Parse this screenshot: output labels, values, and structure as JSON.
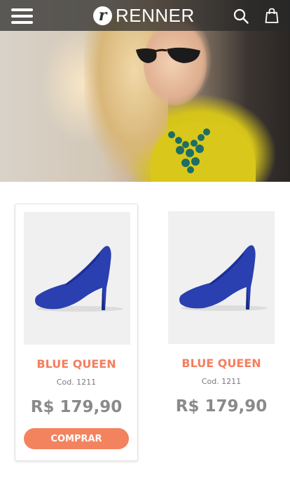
{
  "header": {
    "brand": "RENNER",
    "brand_mark": "r",
    "icons": [
      "menu-icon",
      "search-icon",
      "shopping-bag-icon"
    ]
  },
  "colors": {
    "accent": "#f3835f",
    "product_name": "#f47e5e",
    "price": "#8a8a8a",
    "shoe": "#2a3fb0"
  },
  "products": [
    {
      "name": "BLUE QUEEN",
      "code": "Cod. 1211",
      "price": "R$ 179,90",
      "button": "COMPRAR"
    },
    {
      "name": "BLUE QUEEN",
      "code": "Cod. 1211",
      "price": "R$ 179,90"
    }
  ]
}
